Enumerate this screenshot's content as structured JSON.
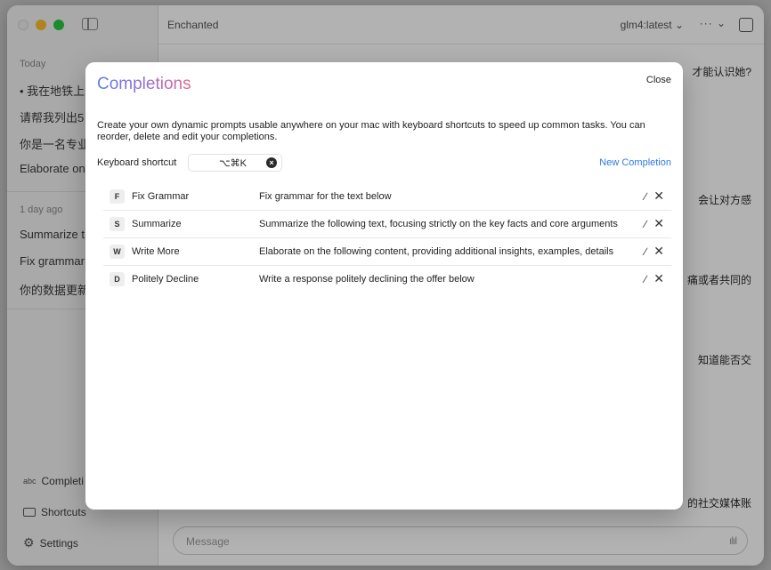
{
  "window": {
    "app_title": "Enchanted",
    "model": "glm4:latest",
    "more_label": "···",
    "message_placeholder": "Message"
  },
  "sidebar": {
    "sections": [
      {
        "label": "Today",
        "items": [
          "• 我在地铁上",
          "请帮我列出5",
          "你是一名专业",
          "Elaborate on"
        ]
      },
      {
        "label": "1 day ago",
        "items": [
          "Summarize t",
          "Fix grammar",
          "你的数据更新"
        ]
      }
    ],
    "bottom": {
      "completions": "Completi",
      "shortcuts": "Shortcuts",
      "settings": "Settings"
    }
  },
  "chat_snippets": [
    "才能认识她?",
    "会让对方感",
    "痛或者共同的",
    "知道能否交",
    "的社交媒体账"
  ],
  "modal": {
    "title": "Completions",
    "close_label": "Close",
    "description": "Create your own dynamic prompts usable anywhere on your mac with keyboard shortcuts to speed up common tasks. You can reorder, delete and edit your completions.",
    "shortcut_label": "Keyboard shortcut",
    "shortcut_value": "⌥⌘K",
    "new_completion_label": "New Completion",
    "completions": [
      {
        "key": "F",
        "name": "Fix Grammar",
        "prompt": "Fix grammar for the text below"
      },
      {
        "key": "S",
        "name": "Summarize",
        "prompt": "Summarize the following text, focusing strictly on the key facts and core arguments"
      },
      {
        "key": "W",
        "name": "Write More",
        "prompt": "Elaborate on the following content, providing additional insights, examples, details"
      },
      {
        "key": "D",
        "name": "Politely Decline",
        "prompt": "Write a response politely declining the offer below"
      }
    ]
  },
  "colors": {
    "accent_blue": "#2f7be0",
    "title_gradient_start": "#5b7fe0",
    "title_gradient_end": "#e06a8c"
  }
}
